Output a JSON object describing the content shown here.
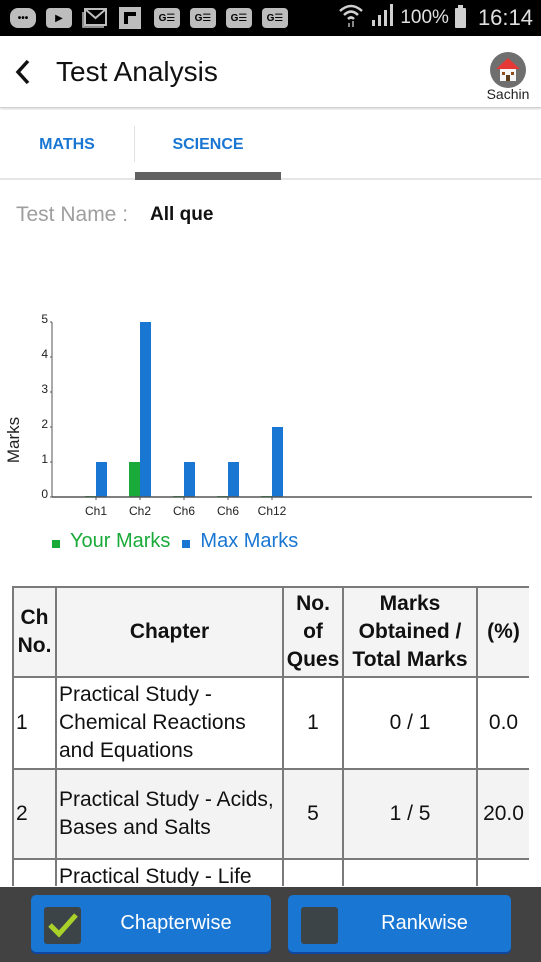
{
  "status_bar": {
    "notification_icons": [
      "chat-icon",
      "youtube-icon",
      "gmail-icon",
      "flipboard-icon",
      "news-icon",
      "news-icon",
      "news-icon",
      "news-icon"
    ],
    "battery": "100%",
    "time": "16:14"
  },
  "app_bar": {
    "title": "Test Analysis",
    "profile_name": "Sachin"
  },
  "tabs": [
    {
      "label": "MATHS",
      "selected": false
    },
    {
      "label": "SCIENCE",
      "selected": true
    }
  ],
  "test_name": {
    "label": "Test Name :",
    "value": "All que"
  },
  "colors": {
    "accent": "#1976d2",
    "your_marks": "#1aaa3a",
    "max_marks": "#1976d2",
    "bottom_bar": "#424242"
  },
  "chart_data": {
    "type": "bar",
    "title": "",
    "xlabel": "",
    "ylabel": "Marks",
    "ylim": [
      0,
      5
    ],
    "yticks": [
      0,
      1,
      2,
      3,
      4,
      5
    ],
    "categories": [
      "Ch1",
      "Ch2",
      "Ch6",
      "Ch6",
      "Ch12"
    ],
    "series": [
      {
        "name": "Your Marks",
        "color": "#1aaa3a",
        "values": [
          0,
          1,
          0,
          0,
          0
        ]
      },
      {
        "name": "Max Marks",
        "color": "#1976d2",
        "values": [
          1,
          5,
          1,
          1,
          2
        ]
      }
    ],
    "legend": "bottom-left",
    "grid": false
  },
  "table": {
    "headers": [
      "Ch No.",
      "Chapter",
      "No. of Ques",
      "Marks Obtained / Total Marks",
      "(%)"
    ],
    "rows": [
      {
        "ch_no": "1",
        "chapter": "Practical Study - Chemical Reactions and Equations",
        "questions": "1",
        "marks": "0 / 1",
        "percent": "0.0"
      },
      {
        "ch_no": "2",
        "chapter": "Practical Study - Acids, Bases and Salts",
        "questions": "5",
        "marks": "1 / 5",
        "percent": "20.0"
      },
      {
        "ch_no": "",
        "chapter": "Practical Study - Life",
        "questions": "",
        "marks": "",
        "percent": ""
      }
    ]
  },
  "bottom_bar": {
    "chapterwise": {
      "label": "Chapterwise",
      "checked": true
    },
    "rankwise": {
      "label": "Rankwise",
      "checked": false
    }
  }
}
